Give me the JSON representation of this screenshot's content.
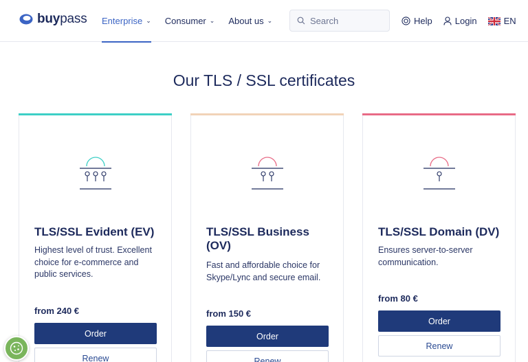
{
  "brand": {
    "name_bold": "buy",
    "name_regular": "pass",
    "accent": "#3b64c4",
    "primary": "#1f3a7a"
  },
  "nav": {
    "items": [
      {
        "label": "Enterprise",
        "active": true
      },
      {
        "label": "Consumer",
        "active": false
      },
      {
        "label": "About us",
        "active": false
      }
    ]
  },
  "search": {
    "placeholder": "Search"
  },
  "links": {
    "help": "Help",
    "login": "Login",
    "language": "EN"
  },
  "page": {
    "title": "Our TLS / SSL certificates"
  },
  "cards": [
    {
      "title": "TLS/SSL Evident (EV)",
      "description": "Highest level of trust. Excellent choice for e-commerce and public services.",
      "price": "from 240 €",
      "order_label": "Order",
      "renew_label": "Renew",
      "accent_color": "#3dcfc6"
    },
    {
      "title": "TLS/SSL Business (OV)",
      "description": "Fast and affordable choice for Skype/Lync and secure email.",
      "price": "from 150 €",
      "order_label": "Order",
      "renew_label": "Renew",
      "accent_color": "#f1d3b8"
    },
    {
      "title": "TLS/SSL Domain (DV)",
      "description": "Ensures server-to-server communication.",
      "price": "from 80 €",
      "order_label": "Order",
      "renew_label": "Renew",
      "accent_color": "#e86b86"
    }
  ],
  "icons": {
    "logo": "buypass-logo-icon",
    "search": "search-icon",
    "help": "help-lifebuoy-icon",
    "login": "user-icon",
    "language": "uk-flag-icon",
    "cookie": "cookie-icon"
  }
}
